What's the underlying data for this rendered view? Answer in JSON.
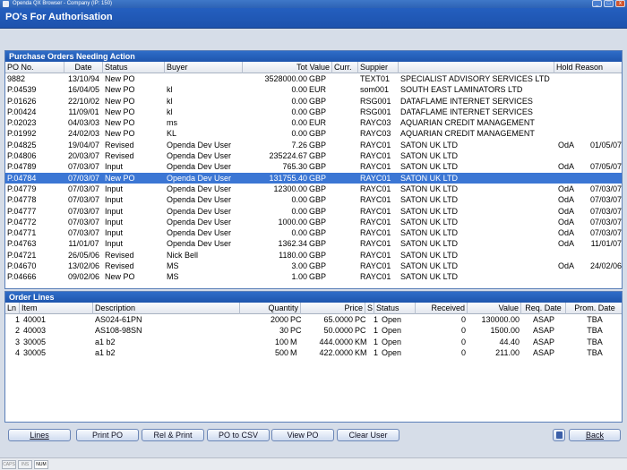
{
  "window": {
    "title": "Openda QX Browser  -  Company (IP: 150)",
    "buttons": [
      "_",
      "□",
      "x"
    ]
  },
  "header": {
    "title": "PO's For Authorisation"
  },
  "po_panel": {
    "title": "Purchase Orders Needing Action",
    "columns": [
      "PO No.",
      "Date",
      "Status",
      "Buyer",
      "Tot Value",
      "Curr.",
      "Suppier",
      "",
      "Hold Reason"
    ],
    "rows": [
      [
        "9882",
        "13/10/94",
        "New PO",
        "",
        "3528000.00",
        "GBP",
        "TEXT01",
        "SPECIALIST ADVISORY SERVICES LTD",
        "",
        ""
      ],
      [
        "P.04539",
        "16/04/05",
        "New PO",
        "kl",
        "0.00",
        "EUR",
        "som001",
        "SOUTH EAST LAMINATORS LTD",
        "",
        ""
      ],
      [
        "P.01626",
        "22/10/02",
        "New PO",
        "kl",
        "0.00",
        "GBP",
        "RSG001",
        "DATAFLAME INTERNET SERVICES",
        "",
        ""
      ],
      [
        "P.00424",
        "11/09/01",
        "New PO",
        "kl",
        "0.00",
        "GBP",
        "RSG001",
        "DATAFLAME INTERNET SERVICES",
        "",
        ""
      ],
      [
        "P.02023",
        "04/03/03",
        "New PO",
        "ms",
        "0.00",
        "EUR",
        "RAYC03",
        "AQUARIAN CREDIT MANAGEMENT",
        "",
        ""
      ],
      [
        "P.01992",
        "24/02/03",
        "New PO",
        "KL",
        "0.00",
        "GBP",
        "RAYC03",
        "AQUARIAN CREDIT MANAGEMENT",
        "",
        ""
      ],
      [
        "P.04825",
        "19/04/07",
        "Revised",
        "Openda Dev User",
        "7.26",
        "GBP",
        "RAYC01",
        "SATON UK LTD",
        "OdA",
        "01/05/07"
      ],
      [
        "P.04806",
        "20/03/07",
        "Revised",
        "Openda Dev User",
        "235224.67",
        "GBP",
        "RAYC01",
        "SATON UK LTD",
        "",
        ""
      ],
      [
        "P.04789",
        "07/03/07",
        "Input",
        "Openda Dev User",
        "765.30",
        "GBP",
        "RAYC01",
        "SATON UK LTD",
        "OdA",
        "07/05/07"
      ],
      [
        "P.04784",
        "07/03/07",
        "New PO",
        "Openda Dev User",
        "131755.40",
        "GBP",
        "RAYC01",
        "SATON UK LTD",
        "",
        ""
      ],
      [
        "P.04779",
        "07/03/07",
        "Input",
        "Openda Dev User",
        "12300.00",
        "GBP",
        "RAYC01",
        "SATON UK LTD",
        "OdA",
        "07/03/07"
      ],
      [
        "P.04778",
        "07/03/07",
        "Input",
        "Openda Dev User",
        "0.00",
        "GBP",
        "RAYC01",
        "SATON UK LTD",
        "OdA",
        "07/03/07"
      ],
      [
        "P.04777",
        "07/03/07",
        "Input",
        "Openda Dev User",
        "0.00",
        "GBP",
        "RAYC01",
        "SATON UK LTD",
        "OdA",
        "07/03/07"
      ],
      [
        "P.04772",
        "07/03/07",
        "Input",
        "Openda Dev User",
        "1000.00",
        "GBP",
        "RAYC01",
        "SATON UK LTD",
        "OdA",
        "07/03/07"
      ],
      [
        "P.04771",
        "07/03/07",
        "Input",
        "Openda Dev User",
        "0.00",
        "GBP",
        "RAYC01",
        "SATON UK LTD",
        "OdA",
        "07/03/07"
      ],
      [
        "P.04763",
        "11/01/07",
        "Input",
        "Openda Dev User",
        "1362.34",
        "GBP",
        "RAYC01",
        "SATON UK LTD",
        "OdA",
        "11/01/07"
      ],
      [
        "P.04721",
        "26/05/06",
        "Revised",
        "Nick Bell",
        "1180.00",
        "GBP",
        "RAYC01",
        "SATON UK LTD",
        "",
        ""
      ],
      [
        "P.04670",
        "13/02/06",
        "Revised",
        "MS",
        "3.00",
        "GBP",
        "RAYC01",
        "SATON UK LTD",
        "OdA",
        "24/02/06"
      ],
      [
        "P.04666",
        "09/02/06",
        "New PO",
        "MS",
        "1.00",
        "GBP",
        "RAYC01",
        "SATON UK LTD",
        "",
        ""
      ]
    ],
    "selected_index": 9
  },
  "lines_panel": {
    "title": "Order Lines",
    "columns": [
      "Ln",
      "Item",
      "Description",
      "Quantity",
      "Price",
      "S",
      "Status",
      "Received",
      "Value",
      "Req. Date",
      "Prom. Date"
    ],
    "rows": [
      [
        "1",
        "40001",
        "AS024-61PN",
        "2000",
        "PC",
        "65.0000",
        "PC",
        "1",
        "Open",
        "0",
        "130000.00",
        "ASAP",
        "TBA"
      ],
      [
        "2",
        "40003",
        "AS108-98SN",
        "30",
        "PC",
        "50.0000",
        "PC",
        "1",
        "Open",
        "0",
        "1500.00",
        "ASAP",
        "TBA"
      ],
      [
        "3",
        "30005",
        "a1 b2",
        "100",
        "M",
        "444.0000",
        "KM",
        "1",
        "Open",
        "0",
        "44.40",
        "ASAP",
        "TBA"
      ],
      [
        "4",
        "30005",
        "a1 b2",
        "500",
        "M",
        "422.0000",
        "KM",
        "1",
        "Open",
        "0",
        "211.00",
        "ASAP",
        "TBA"
      ]
    ]
  },
  "toolbar": {
    "lines": "Lines",
    "print_po": "Print PO",
    "rel_print": "Rel & Print",
    "po_csv": "PO to CSV",
    "view_po": "View PO",
    "clear_user": "Clear User",
    "back": "Back",
    "icon": "document-icon"
  },
  "statusbar": {
    "caps": "CAPS",
    "ins": "INS",
    "num": "NUM"
  }
}
